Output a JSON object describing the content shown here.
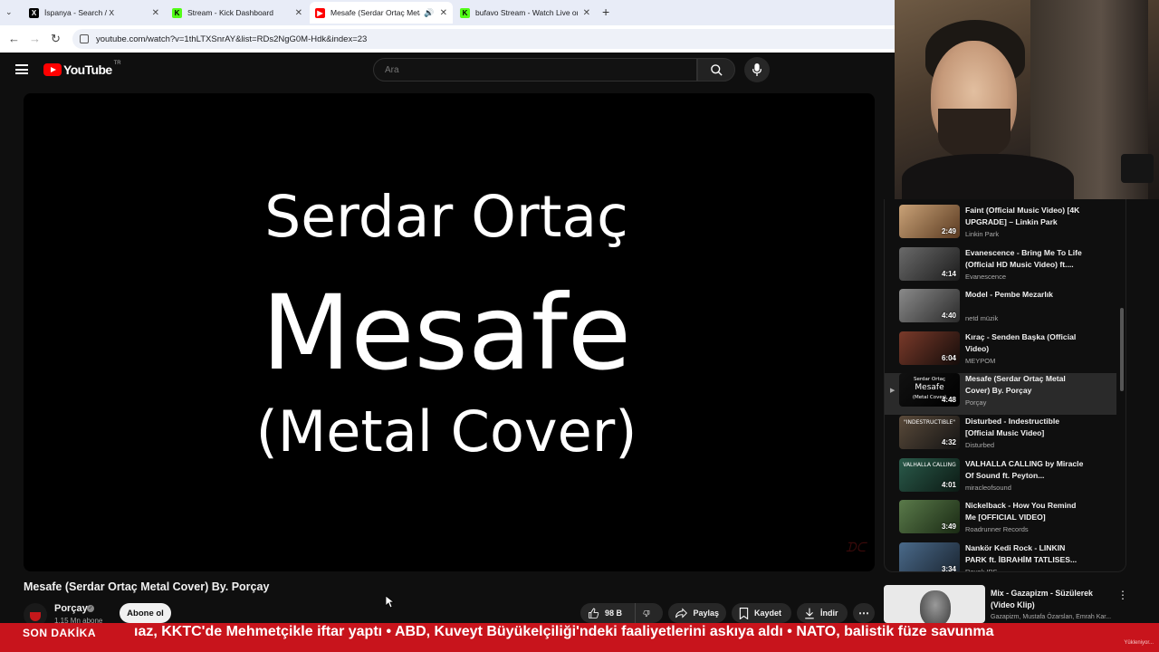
{
  "browser": {
    "tabs": [
      {
        "title": "İspanya - Search / X",
        "icon": "x-logo-icon",
        "icon_color": "#000000"
      },
      {
        "title": "Stream - Kick Dashboard",
        "icon": "kick-logo-icon",
        "icon_color": "#53fc18"
      },
      {
        "title": "Mesafe (Serdar Ortaç Metal",
        "icon": "youtube-logo-icon",
        "icon_color": "#ff0000",
        "active": true,
        "audio": true
      },
      {
        "title": "bufavo Stream - Watch Live on",
        "icon": "kick-logo-icon",
        "icon_color": "#53fc18"
      }
    ],
    "url": "youtube.com/watch?v=1thLTXSnrAY&list=RDs2NgG0M-Hdk&index=23"
  },
  "youtube": {
    "logo_text": "YouTube",
    "country": "TR",
    "search_placeholder": "Ara"
  },
  "player": {
    "line1": "Serdar Ortaç",
    "line2": "Mesafe",
    "line3": "(Metal Cover)",
    "watermark": "ᗪᑕ"
  },
  "video": {
    "title": "Mesafe (Serdar Ortaç Metal Cover) By. Porçay",
    "channel": "Porçay",
    "subscribers": "1,15 Mn abone",
    "subscribe_label": "Abone ol",
    "likes": "98 B",
    "share_label": "Paylaş",
    "save_label": "Kaydet",
    "download_label": "İndir"
  },
  "playlist": [
    {
      "title": "Faint (Official Music Video) [4K UPGRADE] – Linkin Park",
      "channel": "Linkin Park",
      "duration": "2:49",
      "thumb_colors": [
        "#c9a277",
        "#5b3b22"
      ]
    },
    {
      "title": "Evanescence - Bring Me To Life (Official HD Music Video) ft....",
      "channel": "Evanescence",
      "duration": "4:14",
      "thumb_colors": [
        "#6a6a6a",
        "#1c1c1c"
      ]
    },
    {
      "title": "Model - Pembe Mezarlık",
      "channel": "netd müzik",
      "duration": "4:40",
      "thumb_colors": [
        "#8a8a8a",
        "#2a2a2a"
      ]
    },
    {
      "title": "Kıraç - Senden Başka (Official Video)",
      "channel": "MEYPOM",
      "duration": "6:04",
      "thumb_colors": [
        "#7a3a2a",
        "#140c0a"
      ]
    },
    {
      "title": "Mesafe (Serdar Ortaç Metal Cover) By. Porçay",
      "channel": "Porçay",
      "duration": "4:48",
      "thumb_colors": [
        "#111111",
        "#000000"
      ],
      "active": true,
      "thumb_text": [
        "Serdar Ortaç",
        "Mesafe",
        "(Metal Cover)"
      ]
    },
    {
      "title": "Disturbed - Indestructible [Official Music Video]",
      "channel": "Disturbed",
      "duration": "4:32",
      "thumb_colors": [
        "#5a4a3a",
        "#141414"
      ],
      "thumb_text": [
        "\"INDESTRUCTIBLE\""
      ]
    },
    {
      "title": "VALHALLA CALLING by Miracle Of Sound ft. Peyton...",
      "channel": "miracleofsound",
      "duration": "4:01",
      "thumb_colors": [
        "#2a5a4a",
        "#0c1a14"
      ],
      "thumb_text": [
        "VALHALLA CALLING"
      ]
    },
    {
      "title": "Nickelback - How You Remind Me [OFFICIAL VIDEO]",
      "channel": "Roadrunner Records",
      "duration": "3:49",
      "thumb_colors": [
        "#5a7a4a",
        "#1a2a14"
      ]
    },
    {
      "title": "Nankör Kedi Rock - LINKIN PARK ft. İBRAHİM TATLISES...",
      "channel": "Revok IPS",
      "duration": "3:34",
      "thumb_colors": [
        "#4a6a8a",
        "#1a2430"
      ]
    }
  ],
  "mix": {
    "title": "Mix - Gazapizm - Süzülerek (Video Klip)",
    "channels": "Gazapizm, Mustafa Özarslan, Emrah Kar..."
  },
  "ticker": {
    "label": "SON DAKİKA",
    "text": "ıaz, KKTC'de Mehmetçikle iftar yaptı   •   ABD, Kuveyt Büyükelçiliği'ndeki faaliyetlerini askıya aldı   •   NATO, balistik füze savunma",
    "loading": "Yükleniyor..."
  },
  "colors": {
    "youtube_red": "#ff0000",
    "ticker_red": "#c8141c",
    "background": "#0f0f0f"
  }
}
